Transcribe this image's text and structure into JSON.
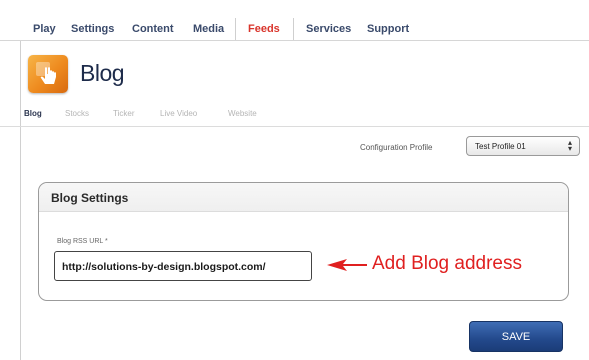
{
  "nav": {
    "tabs": [
      {
        "label": "Play"
      },
      {
        "label": "Settings"
      },
      {
        "label": "Content"
      },
      {
        "label": "Media"
      },
      {
        "label": "Feeds"
      },
      {
        "label": "Services"
      },
      {
        "label": "Support"
      }
    ],
    "active": "Feeds"
  },
  "page": {
    "title": "Blog",
    "logo_icon": "hand-pointer-icon"
  },
  "subtabs": [
    {
      "label": "Blog"
    },
    {
      "label": "Stocks"
    },
    {
      "label": "Ticker"
    },
    {
      "label": "Live Video"
    },
    {
      "label": "Website"
    }
  ],
  "config": {
    "label": "Configuration Profile",
    "selected": "Test Profile 01"
  },
  "settings": {
    "title": "Blog Settings",
    "field_label": "Blog RSS URL *",
    "url_value": "http://solutions-by-design.blogspot.com/"
  },
  "annotation": {
    "text": "Add Blog address",
    "color": "#e02020"
  },
  "buttons": {
    "save_label": "SAVE"
  },
  "colors": {
    "accent": "#d9342b",
    "button": "#2a5298"
  }
}
